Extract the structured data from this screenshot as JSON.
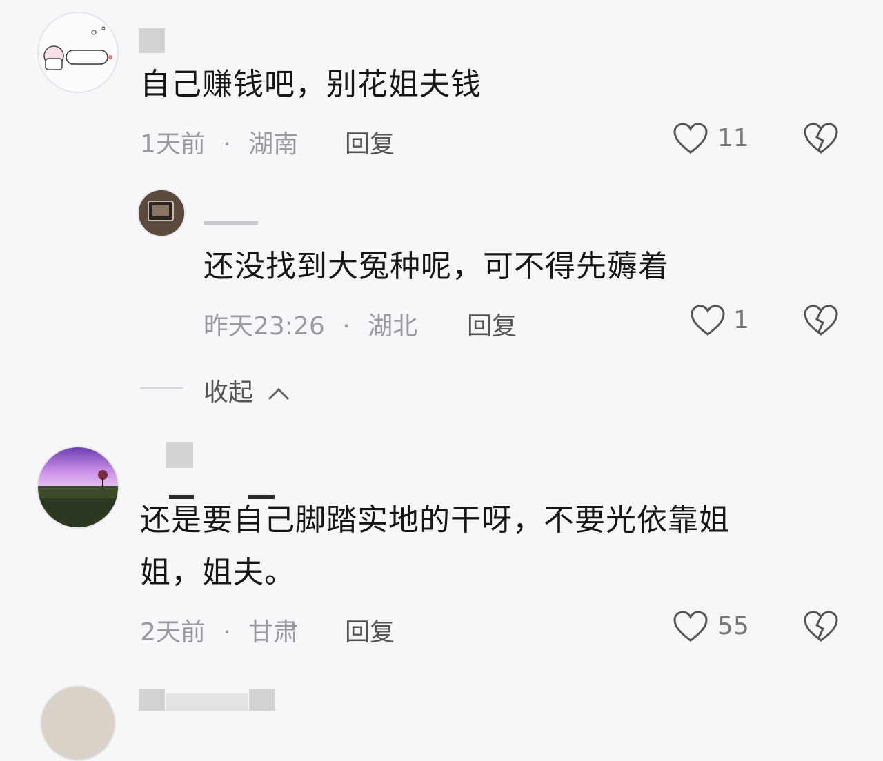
{
  "comments": [
    {
      "text": "自己赚钱吧，别花姐夫钱",
      "time": "1天前",
      "region": "湖南",
      "reply_label": "回复",
      "likes": "11",
      "replies": [
        {
          "text": "还没找到大冤种呢，可不得先薅着",
          "time": "昨天23:26",
          "region": "湖北",
          "reply_label": "回复",
          "likes": "1"
        }
      ],
      "collapse_label": "收起"
    },
    {
      "text_line1": "还是要自己脚踏实地的干呀，不要光依靠姐",
      "text_line2": "姐，姐夫。",
      "time": "2天前",
      "region": "甘肃",
      "reply_label": "回复",
      "likes": "55"
    }
  ],
  "meta_separator": "·",
  "icons": {
    "like": "heart-outline-icon",
    "dislike": "broken-heart-icon",
    "collapse": "chevron-up-icon"
  },
  "colors": {
    "background": "#f7f7f9",
    "meta": "#9a9aa0",
    "text": "#161616"
  }
}
